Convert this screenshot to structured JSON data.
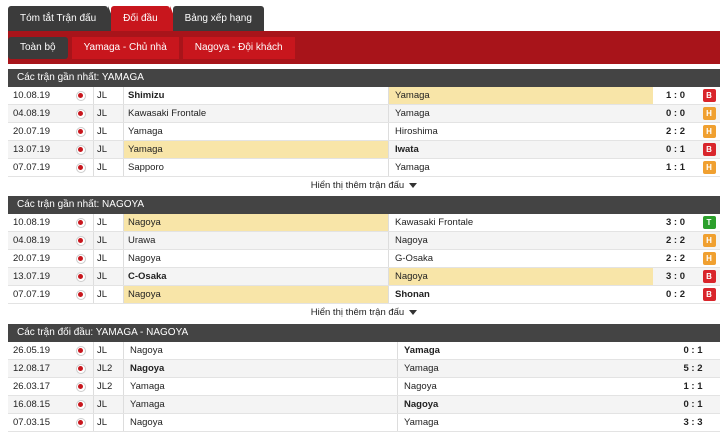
{
  "tabs": [
    {
      "label": "Tóm tắt Trận đấu",
      "active": false
    },
    {
      "label": "Đối đầu",
      "active": true
    },
    {
      "label": "Bảng xếp hạng",
      "active": false
    }
  ],
  "subtabs": [
    {
      "label": "Toàn bộ"
    },
    {
      "label": "Yamaga - Chủ nhà"
    },
    {
      "label": "Nagoya - Đội khách"
    }
  ],
  "colors": {
    "win": "#2ca02c",
    "draw": "#f0a030",
    "loss": "#d9252b",
    "highlight": "#f8e5a8",
    "accent": "#c8161d"
  },
  "sections": [
    {
      "title": "Các trận gần nhất: YAMAGA",
      "more": "Hiển thị thêm trận đấu",
      "rows": [
        {
          "date": "10.08.19",
          "league": "JL",
          "home": "Shimizu",
          "away": "Yamaga",
          "score": "1 : 0",
          "result": "B"
        },
        {
          "date": "04.08.19",
          "league": "JL",
          "home": "Kawasaki Frontale",
          "away": "Yamaga",
          "score": "0 : 0",
          "result": "H"
        },
        {
          "date": "20.07.19",
          "league": "JL",
          "home": "Yamaga",
          "away": "Hiroshima",
          "score": "2 : 2",
          "result": "H"
        },
        {
          "date": "13.07.19",
          "league": "JL",
          "home": "Yamaga",
          "away": "Iwata",
          "score": "0 : 1",
          "result": "B"
        },
        {
          "date": "07.07.19",
          "league": "JL",
          "home": "Sapporo",
          "away": "Yamaga",
          "score": "1 : 1",
          "result": "H"
        }
      ]
    },
    {
      "title": "Các trận gần nhất: NAGOYA",
      "more": "Hiển thị thêm trận đấu",
      "rows": [
        {
          "date": "10.08.19",
          "league": "JL",
          "home": "Nagoya",
          "away": "Kawasaki Frontale",
          "score": "3 : 0",
          "result": "T"
        },
        {
          "date": "04.08.19",
          "league": "JL",
          "home": "Urawa",
          "away": "Nagoya",
          "score": "2 : 2",
          "result": "H"
        },
        {
          "date": "20.07.19",
          "league": "JL",
          "home": "Nagoya",
          "away": "G-Osaka",
          "score": "2 : 2",
          "result": "H"
        },
        {
          "date": "13.07.19",
          "league": "JL",
          "home": "C-Osaka",
          "away": "Nagoya",
          "score": "3 : 0",
          "result": "B"
        },
        {
          "date": "07.07.19",
          "league": "JL",
          "home": "Nagoya",
          "away": "Shonan",
          "score": "0 : 2",
          "result": "B"
        }
      ]
    },
    {
      "title": "Các trận đối đầu: YAMAGA - NAGOYA",
      "rows": [
        {
          "date": "26.05.19",
          "league": "JL",
          "home": "Nagoya",
          "away": "Yamaga",
          "score": "0 : 1"
        },
        {
          "date": "12.08.17",
          "league": "JL2",
          "home": "Nagoya",
          "away": "Yamaga",
          "score": "5 : 2"
        },
        {
          "date": "26.03.17",
          "league": "JL2",
          "home": "Yamaga",
          "away": "Nagoya",
          "score": "1 : 1"
        },
        {
          "date": "16.08.15",
          "league": "JL",
          "home": "Yamaga",
          "away": "Nagoya",
          "score": "0 : 1"
        },
        {
          "date": "07.03.15",
          "league": "JL",
          "home": "Nagoya",
          "away": "Yamaga",
          "score": "3 : 3"
        }
      ]
    }
  ]
}
